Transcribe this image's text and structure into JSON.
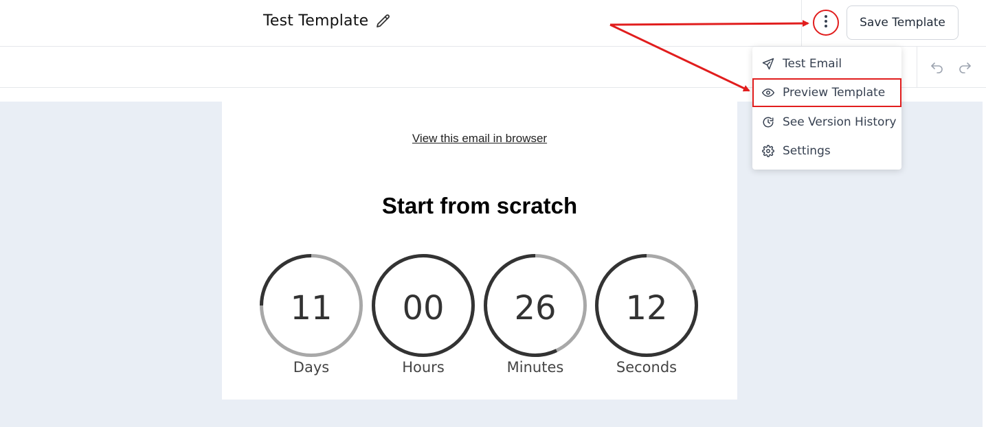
{
  "header": {
    "title": "Test Template",
    "save_label": "Save Template"
  },
  "menu": {
    "items": [
      {
        "label": "Test Email",
        "icon": "send-icon"
      },
      {
        "label": "Preview Template",
        "icon": "eye-icon"
      },
      {
        "label": "See Version History",
        "icon": "history-icon"
      },
      {
        "label": "Settings",
        "icon": "gear-icon"
      }
    ]
  },
  "email": {
    "view_link": "View this email in browser",
    "heading": "Start from scratch",
    "timers": [
      {
        "value": "11",
        "label": "Days",
        "progress": 0.25
      },
      {
        "value": "00",
        "label": "Hours",
        "progress": 1.0
      },
      {
        "value": "26",
        "label": "Minutes",
        "progress": 0.57
      },
      {
        "value": "12",
        "label": "Seconds",
        "progress": 0.8
      }
    ]
  },
  "colors": {
    "annotation": "#e11d1d",
    "canvas_bg": "#e9eef5",
    "ring_dark": "#333333",
    "ring_light": "#a8a8a8"
  }
}
